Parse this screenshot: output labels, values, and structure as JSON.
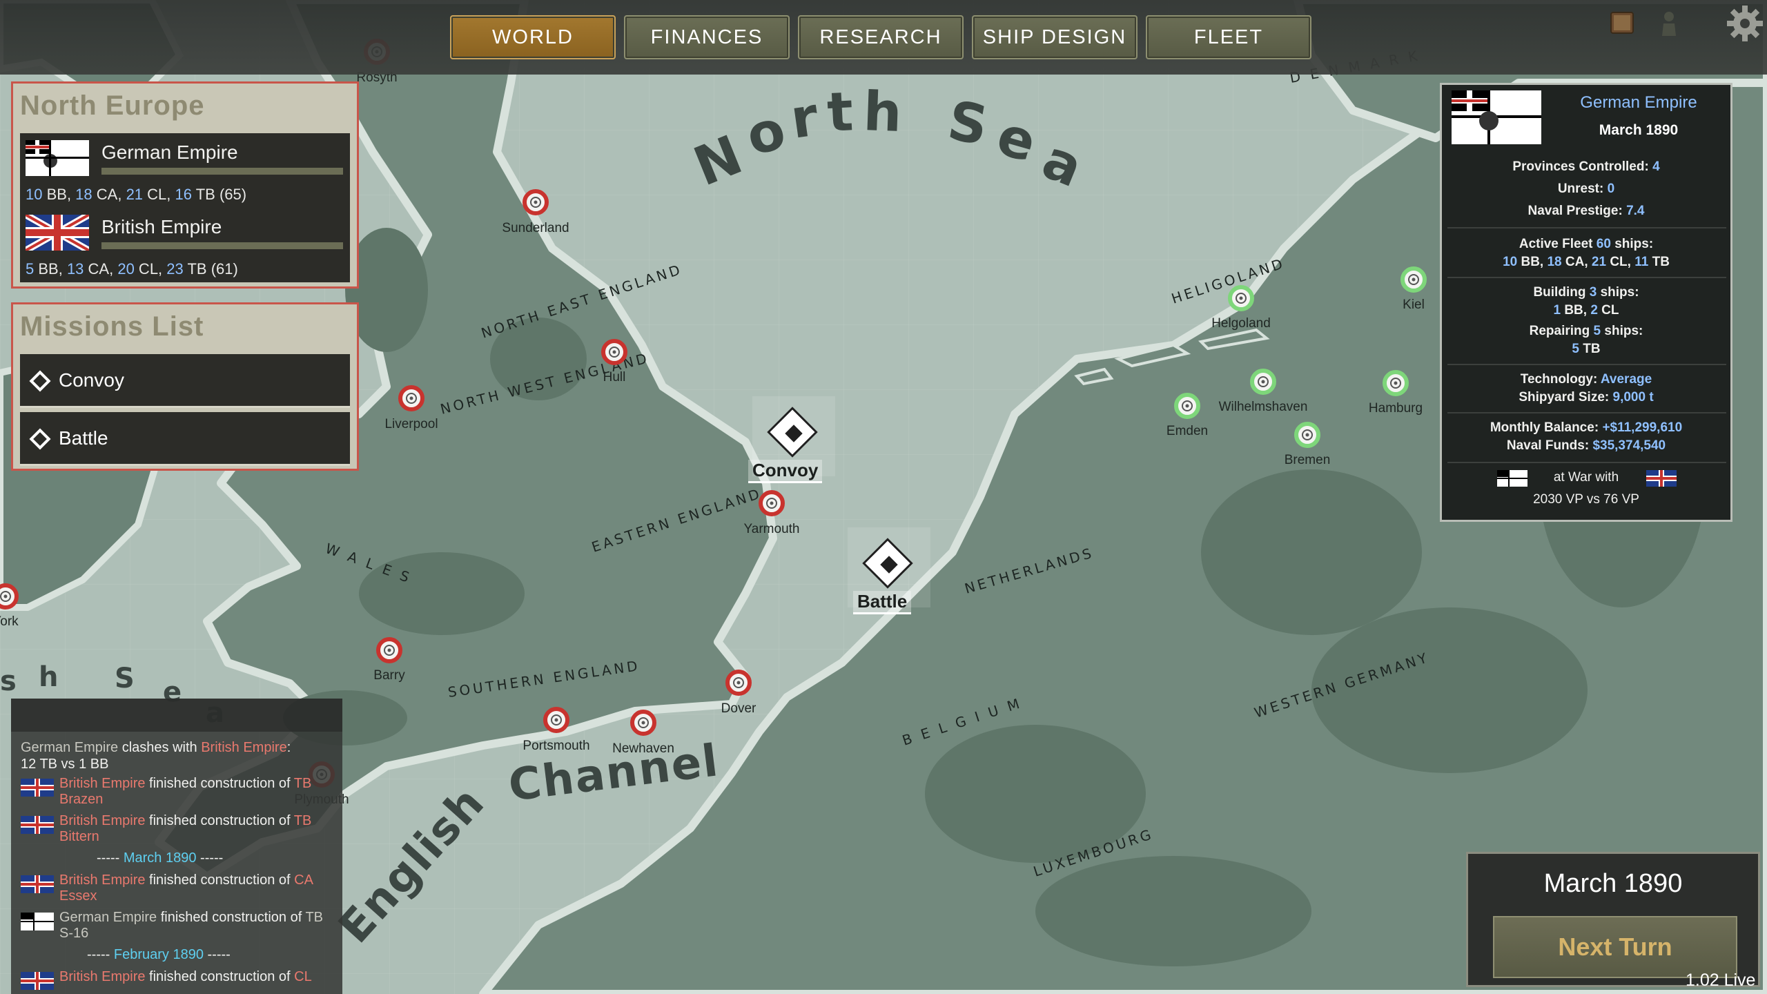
{
  "topbar": {
    "tabs": [
      "WORLD",
      "FINANCES",
      "RESEARCH",
      "SHIP DESIGN",
      "FLEET"
    ],
    "active_tab": "WORLD"
  },
  "region_panel": {
    "title": "North Europe",
    "nations": [
      {
        "name": "German Empire",
        "bb": "10",
        "ca": "18",
        "cl": "21",
        "tb": "16",
        "total": "(65)"
      },
      {
        "name": "British Empire",
        "bb": "5",
        "ca": "13",
        "cl": "20",
        "tb": "23",
        "total": "(61)"
      }
    ]
  },
  "missions": {
    "title": "Missions List",
    "items": [
      "Convoy",
      "Battle"
    ]
  },
  "map": {
    "sea_labels": [
      "North Sea",
      "English Channel",
      "h",
      "S",
      "e",
      "a"
    ],
    "regions": [
      "NORTH EAST ENGLAND",
      "NORTH WEST ENGLAND",
      "WALES",
      "EASTERN ENGLAND",
      "SOUTHERN ENGLAND",
      "NETHERLANDS",
      "BELGIUM",
      "LUXEMBOURG",
      "WESTERN GERMANY",
      "HELIGOLAND",
      "DENMARK"
    ],
    "british_ports": [
      "Rosyth",
      "Sunderland",
      "Hull",
      "Liverpool",
      "Yarmouth",
      "Barry",
      "Portsmouth",
      "Newhaven",
      "Dover",
      "Plymouth",
      "York"
    ],
    "german_ports": [
      "Helgoland",
      "Kiel",
      "Emden",
      "Wilhelmshaven",
      "Hamburg",
      "Bremen"
    ],
    "mission_markers": [
      "Convoy",
      "Battle"
    ]
  },
  "log": {
    "lines": [
      {
        "a": "German Empire",
        "b": " clashes with ",
        "c": "British Empire",
        "d": ":"
      },
      {
        "text": "12 TB vs 1 BB"
      },
      {
        "nation": "British Empire",
        "mid": " finished construction of ",
        "ship1": "TB",
        "ship2": "Brazen"
      },
      {
        "nation": "British Empire",
        "mid": " finished construction of ",
        "ship1": "TB",
        "ship2": "Bittern"
      },
      {
        "sep_left": "----- ",
        "date": "March 1890",
        "sep_right": " -----"
      },
      {
        "nation": "British Empire",
        "mid": " finished construction of ",
        "ship1": "CA",
        "ship2": "Essex"
      },
      {
        "nation": "German Empire",
        "mid": " finished construction of ",
        "ship1": "TB",
        "ship2": "S-16"
      },
      {
        "sep_left": "----- ",
        "date": "February 1890",
        "sep_right": " -----"
      },
      {
        "nation": "British Empire",
        "mid": " finished construction of ",
        "ship1": "CL",
        "ship2": ""
      }
    ]
  },
  "nation_panel": {
    "name": "German Empire",
    "date": "March 1890",
    "provinces_label": "Provinces Controlled:",
    "provinces": "4",
    "unrest_label": "Unrest:",
    "unrest": "0",
    "prestige_label": "Naval Prestige:",
    "prestige": "7.4",
    "fleet_label": "Active Fleet",
    "fleet_count": "60",
    "ships_word": "ships:",
    "fleet_bb": "10",
    "fleet_ca": "18",
    "fleet_cl": "21",
    "fleet_tb": "11",
    "building_label": "Building",
    "building_count": "3",
    "building_bb": "1",
    "building_cl": "2",
    "repairing_label": "Repairing",
    "repairing_count": "5",
    "repairing_tb": "5",
    "tech_label": "Technology:",
    "tech": "Average",
    "shipyard_label": "Shipyard Size:",
    "shipyard": "9,000 t",
    "balance_label": "Monthly Balance:",
    "balance": "+$11,299,610",
    "funds_label": "Naval Funds:",
    "funds": "$35,374,540",
    "war_text": "at War with",
    "vp_text": "2030 VP vs 76 VP"
  },
  "turn": {
    "date": "March 1890",
    "button": "Next Turn"
  },
  "version": "1.02 Live",
  "colors": {
    "active_tab": "#a3782f",
    "accent_blue": "#8fc0ff",
    "british_red": "#e9796e",
    "log_cyan": "#5ecff0",
    "panel_border": "#c9554a",
    "british_port": "#c8332e",
    "german_port": "#7ed67a"
  },
  "icons": [
    "settings-gear-icon",
    "book-icon",
    "soldier-icon"
  ]
}
